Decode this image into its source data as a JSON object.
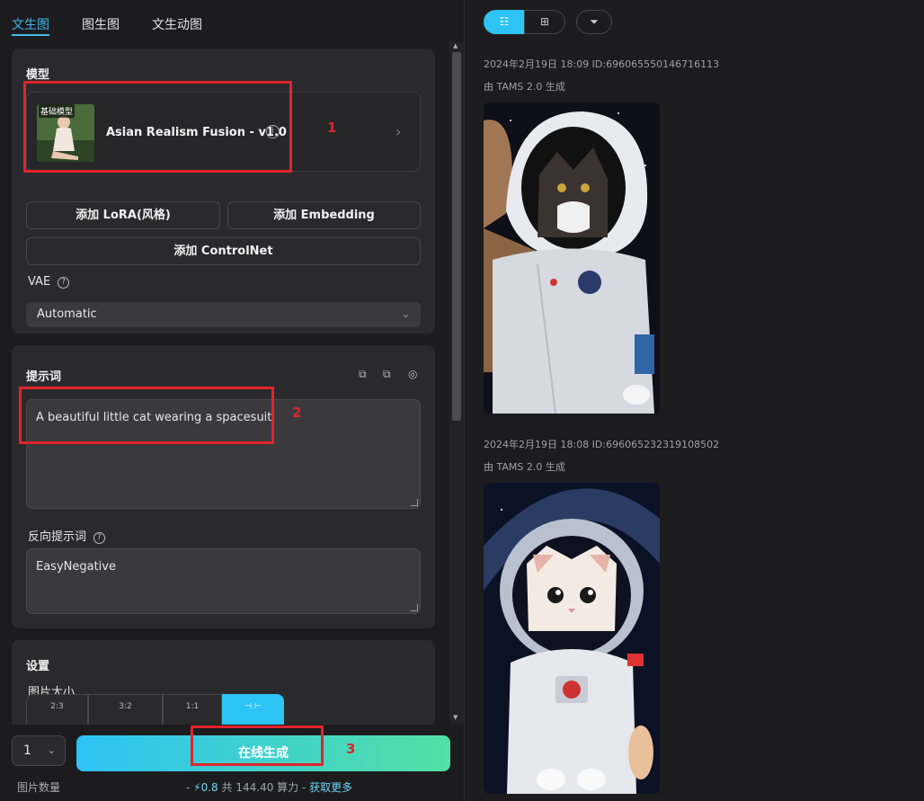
{
  "tabs": [
    {
      "label": "文生图",
      "active": true
    },
    {
      "label": "图生图"
    },
    {
      "label": "文生动图"
    }
  ],
  "model_section": {
    "title": "模型",
    "badge": "基础模型",
    "model_name": "Asian Realism Fusion - v1.0",
    "info_icon": "i",
    "chevron": "›",
    "buttons": {
      "lora": "添加 LoRA(风格)",
      "embedding": "添加 Embedding",
      "controlnet": "添加 ControlNet"
    },
    "vae_label": "VAE",
    "help_icon": "?",
    "vae_value": "Automatic",
    "dropdown_icon": "⌄"
  },
  "prompt_section": {
    "title": "提示词",
    "icons": [
      "⧉",
      "⧉",
      "◎"
    ],
    "prompt": "A beautiful little cat wearing a spacesuit",
    "negative_label": "反向提示词",
    "negative_prompt": "EasyNegative"
  },
  "settings_section": {
    "title": "设置",
    "size_label": "图片大小",
    "size_options": [
      {
        "label": "2:3"
      },
      {
        "label": "3:2"
      },
      {
        "label": "1:1"
      },
      {
        "label": "⊣ ⊢",
        "selected": true
      }
    ]
  },
  "bottom": {
    "count": "1",
    "generate": "在线生成",
    "qty_label": "图片数量",
    "cost_prefix": "-",
    "cost_icon": "⚡",
    "cost_value": "0.8",
    "cost_total": "共 144.40 算力 -",
    "get_more": "获取更多"
  },
  "right": {
    "toolbar": {
      "list_icon": "☷",
      "grid_icon": "⊞",
      "filter_icon": "⏷"
    },
    "items": [
      {
        "meta": "2024年2月19日 18:09 ID:696065550146716113",
        "by": "由 TAMS 2.0 生成"
      },
      {
        "meta": "2024年2月19日 18:08 ID:696065232319108502",
        "by": "由 TAMS 2.0 生成"
      }
    ]
  },
  "annotations": [
    "1",
    "2",
    "3"
  ],
  "colors": {
    "accent": "#41b8e9",
    "annotation": "#e0242c",
    "gradient_start": "#2ec3f5",
    "gradient_end": "#52e0a4"
  }
}
